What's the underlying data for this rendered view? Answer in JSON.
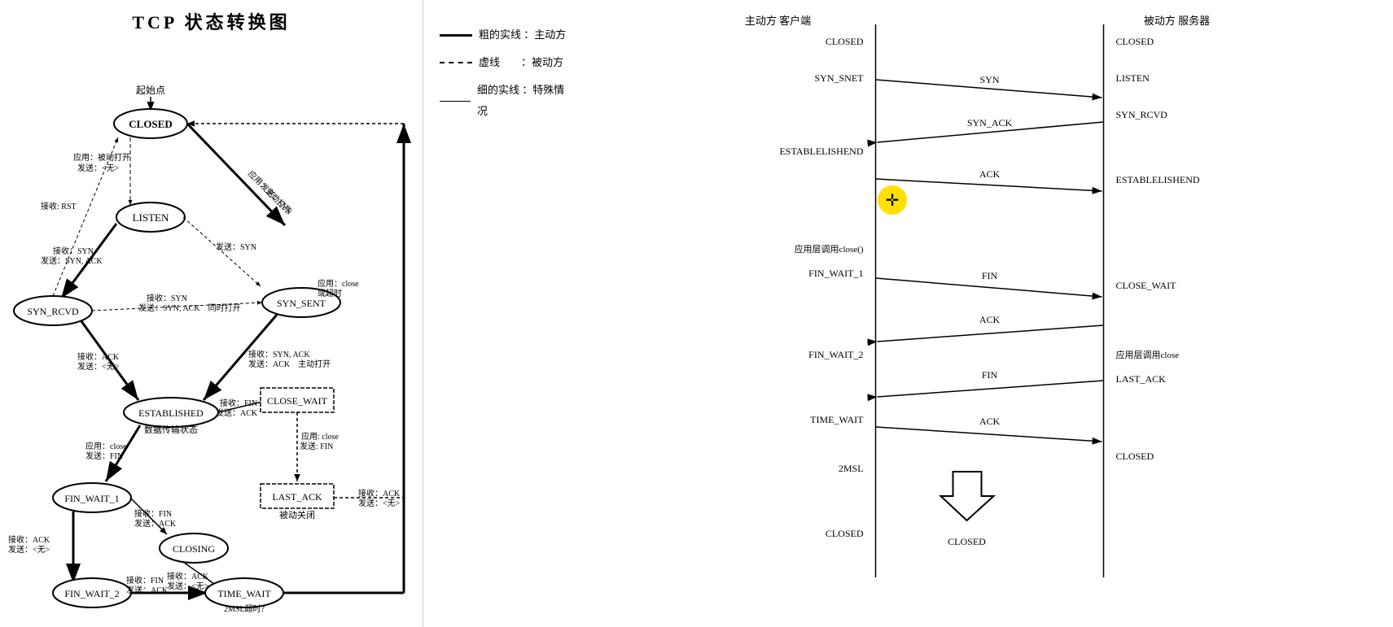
{
  "title": "TCP 状态转换图",
  "legend": {
    "items": [
      {
        "label": "粗的实线 ：主动方",
        "type": "thick"
      },
      {
        "label": "虚线　　：被动方",
        "type": "dashed"
      },
      {
        "label": "细的实线 ：特殊情况",
        "type": "thin"
      }
    ]
  },
  "states": {
    "closed": "CLOSED",
    "listen": "LISTEN",
    "syn_rcvd": "SYN_RCVD",
    "syn_sent": "SYN_SENT",
    "established": "ESTABLISHED",
    "close_wait": "CLOSE_WAIT",
    "last_ack": "LAST_ACK",
    "fin_wait_1": "FIN_WAIT_1",
    "closing": "CLOSING",
    "fin_wait_2": "FIN_WAIT_2",
    "time_wait": "TIME_WAIT"
  },
  "right_diagram": {
    "header_left": "主动方 客户端",
    "header_right": "被动方 服务器",
    "states_left": [
      "CLOSED",
      "SYN_SNET",
      "ESTABLELISHEND",
      "应用层调用close()",
      "FIN_WAIT_1",
      "FIN_WAIT_2",
      "TIME_WAIT",
      "2MSL",
      "CLOSED"
    ],
    "states_right": [
      "CLOSED",
      "LISTEN",
      "SYN_RCVD",
      "ESTABLELISHEND",
      "CLOSE_WAIT",
      "应用层调用close",
      "LAST_ACK",
      "CLOSED"
    ],
    "arrows": [
      {
        "label": "SYN",
        "direction": "right"
      },
      {
        "label": "SYN_ACK",
        "direction": "left"
      },
      {
        "label": "ACK",
        "direction": "right"
      },
      {
        "label": "FIN",
        "direction": "right"
      },
      {
        "label": "ACK",
        "direction": "left"
      },
      {
        "label": "FIN",
        "direction": "left"
      },
      {
        "label": "ACK",
        "direction": "right"
      }
    ]
  }
}
